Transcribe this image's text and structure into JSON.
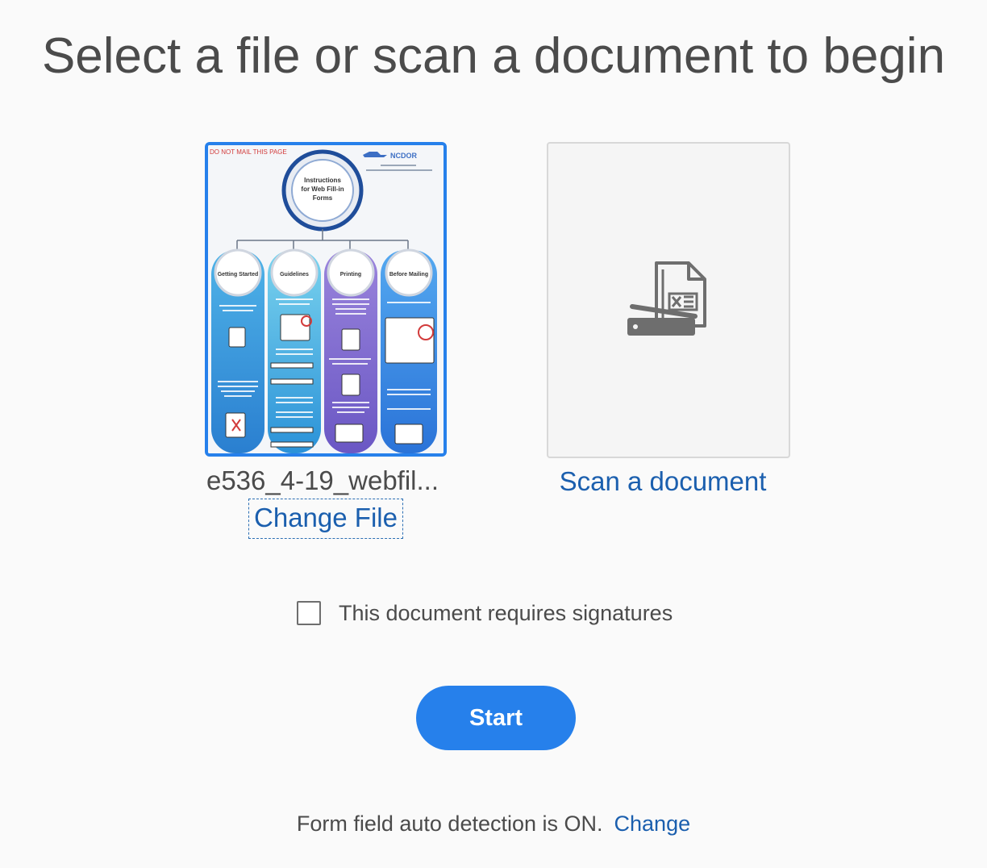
{
  "page": {
    "title": "Select a file or scan a document to begin"
  },
  "file": {
    "name": "e536_4-19_webfil...",
    "change_label": "Change File",
    "thumbnail": {
      "header_text": "DO NOT MAIL THIS PAGE",
      "logo_text": "NCDOR",
      "center_title": [
        "Instructions",
        "for Web Fill-in",
        "Forms"
      ],
      "columns": [
        "Getting Started",
        "Guidelines",
        "Printing",
        "Before Mailing"
      ]
    }
  },
  "scan": {
    "label": "Scan a document",
    "icon": "scanner-document-icon"
  },
  "signature": {
    "label": "This document requires signatures",
    "checked": false
  },
  "start": {
    "label": "Start"
  },
  "footer": {
    "status": "Form field auto detection is ON.",
    "change_label": "Change"
  },
  "colors": {
    "accent": "#2680eb",
    "link": "#1b5fae",
    "text": "#4b4b4b",
    "background": "#fafafa"
  }
}
